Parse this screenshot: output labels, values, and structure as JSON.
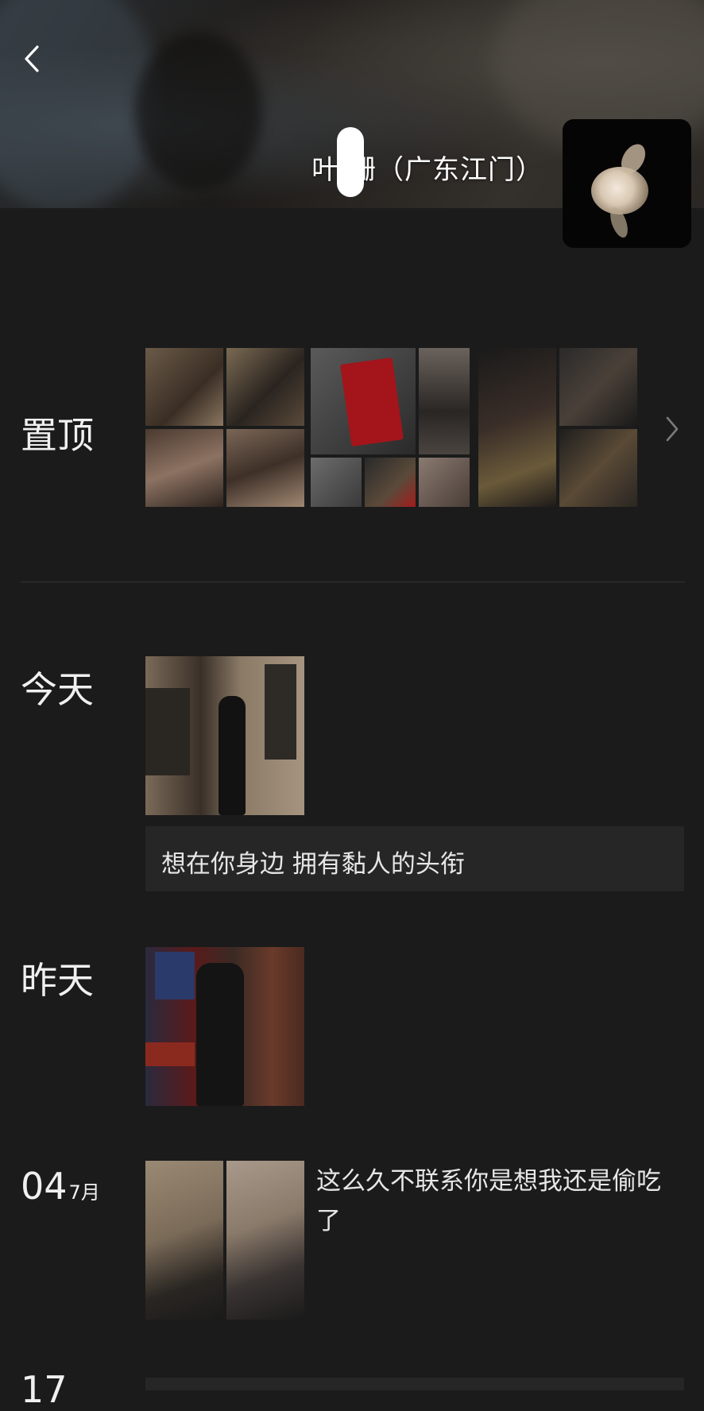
{
  "header": {
    "back_icon": "chevron-left-icon",
    "username": "叶 珊（广东江门）"
  },
  "pinned": {
    "label": "置顶",
    "more_icon": "chevron-right-icon"
  },
  "timeline": [
    {
      "label": "今天",
      "caption": "想在你身边 拥有黏人的头衔"
    },
    {
      "label": "昨天"
    },
    {
      "date_num": "04",
      "date_month": "7月",
      "text": "这么久不联系你是想我还是偷吃了"
    }
  ],
  "footer": {
    "next_date_partial": "17"
  }
}
